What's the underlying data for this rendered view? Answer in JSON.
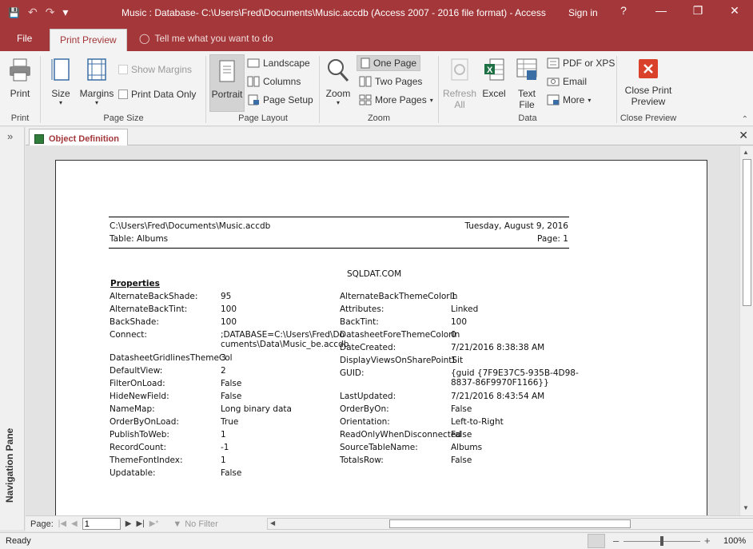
{
  "window": {
    "title": "Music : Database- C:\\Users\\Fred\\Documents\\Music.accdb (Access 2007 - 2016 file format) - Access",
    "sign_in": "Sign in",
    "help": "?",
    "minimize": "—",
    "restore": "❐",
    "close": "✕",
    "qat_save": "💾",
    "qat_undo": "↶",
    "qat_redo": "↷",
    "qat_customize": "▾"
  },
  "ribbon_tabs": {
    "file": "File",
    "print_preview": "Print Preview",
    "tell_me": "Tell me what you want to do"
  },
  "ribbon": {
    "print": "Print",
    "size": "Size",
    "margins": "Margins",
    "show_margins": "Show Margins",
    "print_data_only": "Print Data Only",
    "portrait": "Portrait",
    "landscape": "Landscape",
    "columns": "Columns",
    "page_setup": "Page Setup",
    "zoom": "Zoom",
    "one_page": "One Page",
    "two_pages": "Two Pages",
    "more_pages": "More Pages",
    "refresh_all_1": "Refresh",
    "refresh_all_2": "All",
    "excel": "Excel",
    "text_file_1": "Text",
    "text_file_2": "File",
    "pdf_or_xps": "PDF or XPS",
    "email": "Email",
    "more": "More",
    "close_print_preview_1": "Close Print",
    "close_print_preview_2": "Preview",
    "groups": {
      "print": "Print",
      "page_size": "Page Size",
      "page_layout": "Page Layout",
      "zoom": "Zoom",
      "data": "Data",
      "close_preview": "Close Preview"
    }
  },
  "nav_pane": {
    "label": "Navigation Pane",
    "toggle": "»"
  },
  "doc_tab": {
    "label": "Object Definition",
    "close": "✕"
  },
  "report": {
    "path": "C:\\Users\\Fred\\Documents\\Music.accdb",
    "table": "Table: Albums",
    "date": "Tuesday, August 9, 2016",
    "page": "Page: 1",
    "watermark": "SQLDAT.COM",
    "section": "Properties",
    "left": [
      {
        "k": "AlternateBackShade:",
        "v": "95"
      },
      {
        "k": "AlternateBackTint:",
        "v": "100"
      },
      {
        "k": "BackShade:",
        "v": "100"
      },
      {
        "k": "Connect:",
        "v": ";DATABASE=C:\\Users\\Fred\\Do",
        "v2": "cuments\\Data\\Music_be.accdb"
      },
      {
        "k": "DatasheetGridlinesThemeCol",
        "v": "3"
      },
      {
        "k": "DefaultView:",
        "v": "2"
      },
      {
        "k": "FilterOnLoad:",
        "v": "False"
      },
      {
        "k": "HideNewField:",
        "v": "False"
      },
      {
        "k": "NameMap:",
        "v": "Long binary data"
      },
      {
        "k": "OrderByOnLoad:",
        "v": "True"
      },
      {
        "k": "PublishToWeb:",
        "v": "1"
      },
      {
        "k": "RecordCount:",
        "v": "-1"
      },
      {
        "k": "ThemeFontIndex:",
        "v": "1"
      },
      {
        "k": "Updatable:",
        "v": "False"
      }
    ],
    "right": [
      {
        "k": "AlternateBackThemeColorIn",
        "v": "1"
      },
      {
        "k": "Attributes:",
        "v": "Linked"
      },
      {
        "k": "BackTint:",
        "v": "100"
      },
      {
        "k": "DatasheetForeThemeColorIn",
        "v": "0"
      },
      {
        "k": "DateCreated:",
        "v": "7/21/2016 8:38:38 AM"
      },
      {
        "k": "DisplayViewsOnSharePointSit",
        "v": "1"
      },
      {
        "k": "GUID:",
        "v": "{guid {7F9E37C5-935B-4D98-",
        "v2": "8837-86F9970F1166}}"
      },
      {
        "k": "LastUpdated:",
        "v": "7/21/2016 8:43:54 AM"
      },
      {
        "k": "OrderByOn:",
        "v": "False"
      },
      {
        "k": "Orientation:",
        "v": "Left-to-Right"
      },
      {
        "k": "ReadOnlyWhenDisconnected",
        "v": "False"
      },
      {
        "k": "SourceTableName:",
        "v": "Albums"
      },
      {
        "k": "TotalsRow:",
        "v": "False"
      }
    ]
  },
  "record_nav": {
    "label": "Page:",
    "value": "1",
    "no_filter": "No Filter"
  },
  "status": {
    "ready": "Ready",
    "zoom": "100%",
    "zoom_level": 1.0
  }
}
